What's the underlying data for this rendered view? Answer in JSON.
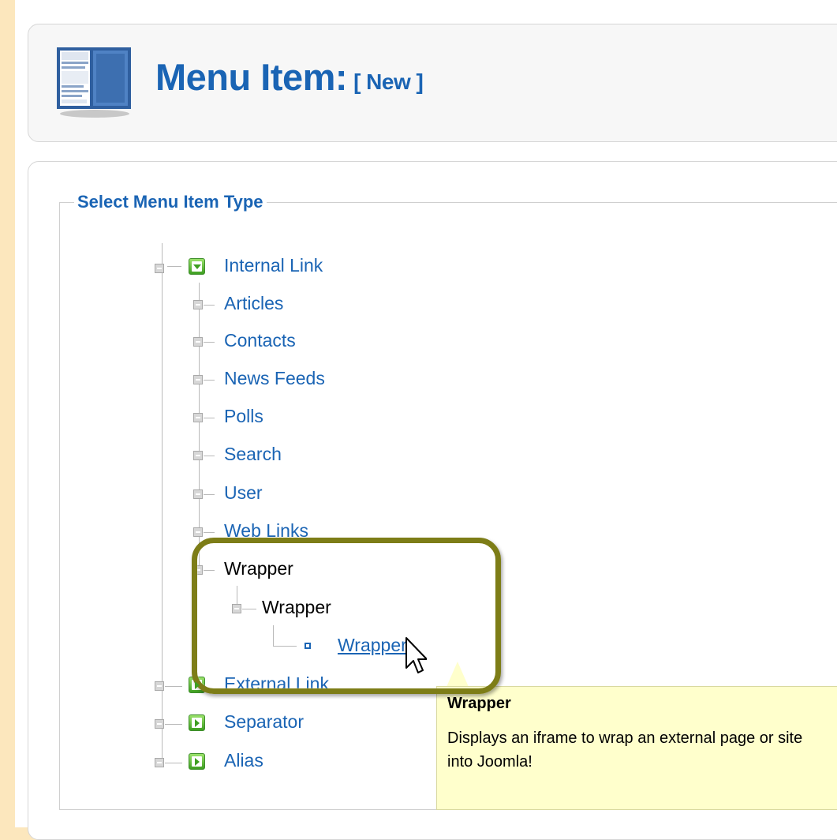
{
  "header": {
    "title": "Menu Item:",
    "subtitle": "[ New ]",
    "icon": "menu-item-icon"
  },
  "section": {
    "legend": "Select Menu Item Type"
  },
  "tree": {
    "internal_link": "Internal Link",
    "children": {
      "articles": "Articles",
      "contacts": "Contacts",
      "news_feeds": "News Feeds",
      "polls": "Polls",
      "search": "Search",
      "user": "User",
      "web_links": "Web Links",
      "wrapper": "Wrapper"
    },
    "wrapper_sub": "Wrapper",
    "wrapper_leaf": "Wrapper",
    "external_link": "External Link",
    "separator": "Separator",
    "alias": "Alias"
  },
  "tooltip": {
    "title": "Wrapper",
    "body": "Displays an iframe to wrap an external page or site into Joomla!"
  },
  "colors": {
    "background": "#fce7bd",
    "link": "#1a64b4",
    "highlight": "#7d7d17",
    "tooltip": "#ffffcc",
    "folder": "#3e9e21"
  }
}
